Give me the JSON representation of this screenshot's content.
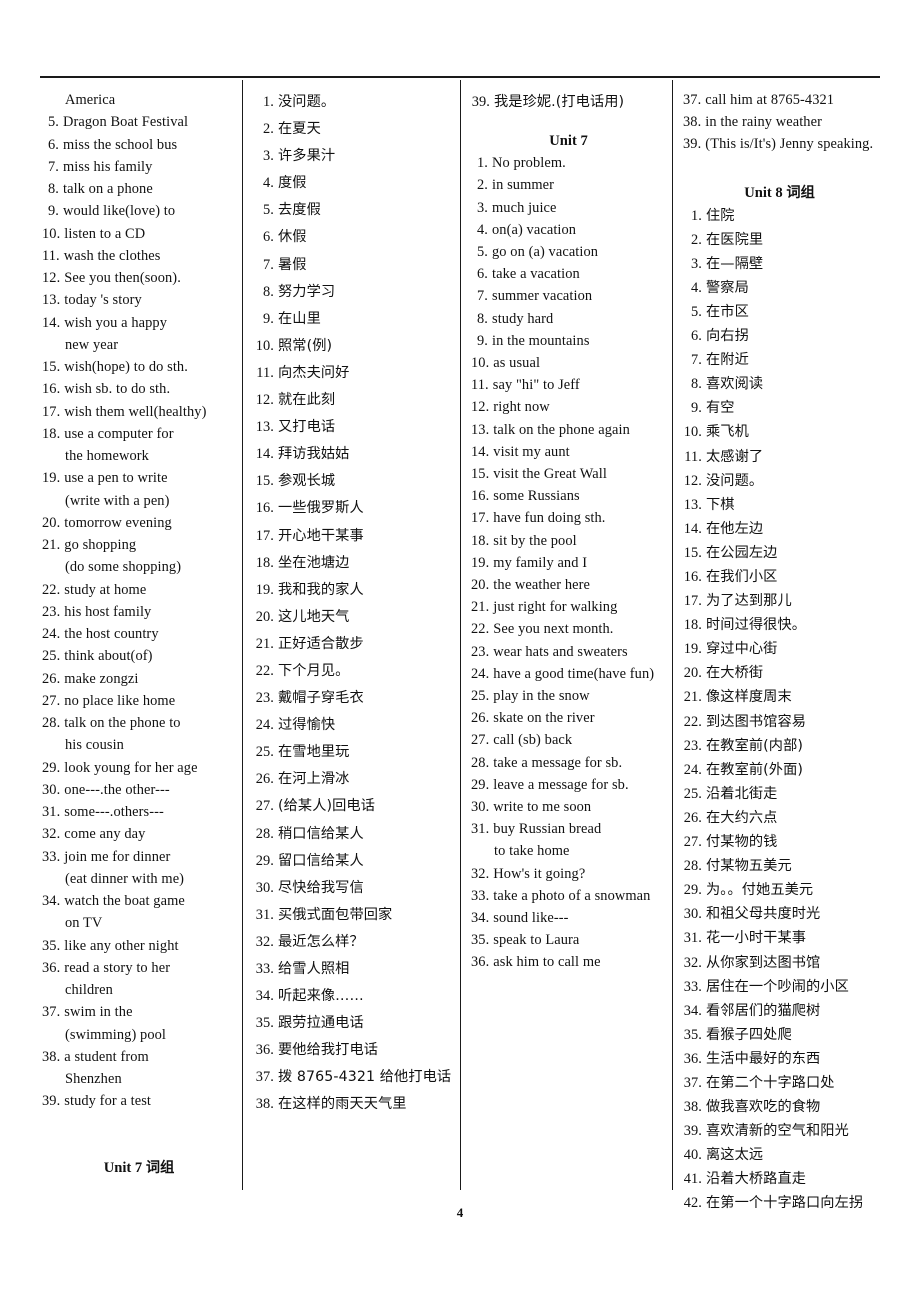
{
  "page": {
    "number": "4"
  },
  "columns": [
    {
      "id": "column-1",
      "lang": "en",
      "blocks": [
        {
          "type": "list",
          "items": [
            {
              "num": "",
              "text": "America",
              "cont": true
            },
            {
              "num": "5.",
              "text": "Dragon Boat Festival"
            },
            {
              "num": "6.",
              "text": "miss the school bus"
            },
            {
              "num": "7.",
              "text": "miss his family"
            },
            {
              "num": "8.",
              "text": "talk on a phone"
            },
            {
              "num": "9.",
              "text": "would like(love) to"
            },
            {
              "num": "10.",
              "text": "listen to a CD"
            },
            {
              "num": "11.",
              "text": "wash the clothes"
            },
            {
              "num": "12.",
              "text": "See you then(soon)."
            },
            {
              "num": "13.",
              "text": "today 's story"
            },
            {
              "num": "14.",
              "text": "wish you a happy"
            },
            {
              "num": "",
              "text": "new year",
              "cont": true
            },
            {
              "num": "15.",
              "text": "wish(hope) to do sth."
            },
            {
              "num": "16.",
              "text": "wish sb. to do sth."
            },
            {
              "num": "17.",
              "text": "wish them well(healthy)"
            },
            {
              "num": "18.",
              "text": "use a computer for"
            },
            {
              "num": "",
              "text": "the homework",
              "cont": true
            },
            {
              "num": "19.",
              "text": "use a pen to write"
            },
            {
              "num": "",
              "text": "(write with a pen)",
              "cont": true
            },
            {
              "num": "20.",
              "text": "tomorrow evening"
            },
            {
              "num": "21.",
              "text": "go shopping"
            },
            {
              "num": "",
              "text": "(do some shopping)",
              "cont": true
            },
            {
              "num": "22.",
              "text": "study at home"
            },
            {
              "num": "23.",
              "text": "his host family"
            },
            {
              "num": "24.",
              "text": "the host country"
            },
            {
              "num": "25.",
              "text": "think about(of)"
            },
            {
              "num": "26.",
              "text": "make zongzi"
            },
            {
              "num": "27.",
              "text": "no place like home"
            },
            {
              "num": "28.",
              "text": "talk on the phone to"
            },
            {
              "num": "",
              "text": "his cousin",
              "cont": true
            },
            {
              "num": "29.",
              "text": "look young for her age"
            },
            {
              "num": "30.",
              "text": "one---.the other---"
            },
            {
              "num": "31.",
              "text": "some---.others---"
            },
            {
              "num": "32.",
              "text": "come any day"
            },
            {
              "num": "33.",
              "text": "join me for dinner"
            },
            {
              "num": "",
              "text": "(eat dinner with me)",
              "cont": true
            },
            {
              "num": "34.",
              "text": "watch the boat game"
            },
            {
              "num": "",
              "text": "on TV",
              "cont": true
            },
            {
              "num": "35.",
              "text": "like any other night"
            },
            {
              "num": "36.",
              "text": "read a story to her"
            },
            {
              "num": "",
              "text": "children",
              "cont": true
            },
            {
              "num": "37.",
              "text": "swim in the"
            },
            {
              "num": "",
              "text": "(swimming) pool",
              "cont": true
            },
            {
              "num": "38.",
              "text": "a student from"
            },
            {
              "num": "",
              "text": "Shenzhen",
              "cont": true
            },
            {
              "num": "39.",
              "text": "study for a test"
            }
          ]
        },
        {
          "type": "spacer",
          "size": "lg"
        },
        {
          "type": "heading",
          "latin": "Unit 7",
          "zh": "词组"
        }
      ]
    },
    {
      "id": "column-2",
      "lang": "zh",
      "blocks": [
        {
          "type": "list",
          "items": [
            {
              "num": "1.",
              "text": "没问题。"
            },
            {
              "num": "2.",
              "text": "在夏天"
            },
            {
              "num": "3.",
              "text": "许多果汁"
            },
            {
              "num": "4.",
              "text": "度假"
            },
            {
              "num": "5.",
              "text": "去度假"
            },
            {
              "num": "6.",
              "text": "休假"
            },
            {
              "num": "7.",
              "text": "暑假"
            },
            {
              "num": "8.",
              "text": "努力学习"
            },
            {
              "num": "9.",
              "text": "在山里"
            },
            {
              "num": "10.",
              "text": "照常(例)"
            },
            {
              "num": "11.",
              "text": "向杰夫问好"
            },
            {
              "num": "12.",
              "text": "就在此刻"
            },
            {
              "num": "13.",
              "text": "又打电话"
            },
            {
              "num": "14.",
              "text": "拜访我姑姑"
            },
            {
              "num": "15.",
              "text": "参观长城"
            },
            {
              "num": "16.",
              "text": "一些俄罗斯人"
            },
            {
              "num": "17.",
              "text": "开心地干某事"
            },
            {
              "num": "18.",
              "text": "坐在池塘边"
            },
            {
              "num": "19.",
              "text": "我和我的家人"
            },
            {
              "num": "20.",
              "text": "这儿地天气"
            },
            {
              "num": "21.",
              "text": "正好适合散步"
            },
            {
              "num": "22.",
              "text": "下个月见。"
            },
            {
              "num": "23.",
              "text": "戴帽子穿毛衣"
            },
            {
              "num": "24.",
              "text": "过得愉快"
            },
            {
              "num": "25.",
              "text": "在雪地里玩"
            },
            {
              "num": "26.",
              "text": "在河上滑冰"
            },
            {
              "num": "27.",
              "text": "(给某人)回电话"
            },
            {
              "num": "28.",
              "text": "稍口信给某人"
            },
            {
              "num": "29.",
              "text": "留口信给某人"
            },
            {
              "num": "30.",
              "text": "尽快给我写信"
            },
            {
              "num": "31.",
              "text": "买俄式面包带回家"
            },
            {
              "num": "32.",
              "text": "最近怎么样？"
            },
            {
              "num": "33.",
              "text": "给雪人照相"
            },
            {
              "num": "34.",
              "text": "听起来像……"
            },
            {
              "num": "35.",
              "text": "跟劳拉通电话"
            },
            {
              "num": "36.",
              "text": "要他给我打电话"
            },
            {
              "num": "37.",
              "text": "拨 8765-4321 给他打电话"
            },
            {
              "num": "38.",
              "text": "在这样的雨天天气里"
            }
          ]
        }
      ]
    },
    {
      "id": "column-3",
      "lang": "mixed",
      "blocks": [
        {
          "type": "list",
          "lang": "zh",
          "items": [
            {
              "num": "39.",
              "text": "我是珍妮.(打电话用)"
            }
          ]
        },
        {
          "type": "spacer",
          "size": "sm"
        },
        {
          "type": "heading",
          "latin": "Unit 7",
          "zh": ""
        },
        {
          "type": "list",
          "lang": "en",
          "items": [
            {
              "num": "1.",
              "text": "No problem."
            },
            {
              "num": "2.",
              "text": "in summer"
            },
            {
              "num": "3.",
              "text": "much juice"
            },
            {
              "num": "4.",
              "text": "on(a) vacation"
            },
            {
              "num": "5.",
              "text": "go on (a) vacation"
            },
            {
              "num": "6.",
              "text": "take a vacation"
            },
            {
              "num": "7.",
              "text": "summer vacation"
            },
            {
              "num": "8.",
              "text": "study hard"
            },
            {
              "num": "9.",
              "text": "in the mountains"
            },
            {
              "num": "10.",
              "text": "as usual"
            },
            {
              "num": "11.",
              "text": "say \"hi\" to Jeff"
            },
            {
              "num": "12.",
              "text": "right now"
            },
            {
              "num": "13.",
              "text": "talk on the phone again"
            },
            {
              "num": "14.",
              "text": "visit my aunt"
            },
            {
              "num": "15.",
              "text": "visit the Great Wall"
            },
            {
              "num": "16.",
              "text": "some Russians"
            },
            {
              "num": "17.",
              "text": "have fun doing sth."
            },
            {
              "num": "18.",
              "text": "sit by the pool"
            },
            {
              "num": "19.",
              "text": "my family and I"
            },
            {
              "num": "20.",
              "text": "the weather here"
            },
            {
              "num": "21.",
              "text": "just right for walking"
            },
            {
              "num": "22.",
              "text": "See you next month."
            },
            {
              "num": "23.",
              "text": "wear hats and sweaters"
            },
            {
              "num": "24.",
              "text": "have a good time(have fun)"
            },
            {
              "num": "25.",
              "text": "play in the snow"
            },
            {
              "num": "26.",
              "text": "skate on the river"
            },
            {
              "num": "27.",
              "text": "call (sb) back"
            },
            {
              "num": "28.",
              "text": "take a message for sb."
            },
            {
              "num": "29.",
              "text": "leave a message for sb."
            },
            {
              "num": "30.",
              "text": "write to me soon"
            },
            {
              "num": "31.",
              "text": "buy Russian bread"
            },
            {
              "num": "",
              "text": "to take home",
              "cont": true
            },
            {
              "num": "32.",
              "text": "How's it going?"
            },
            {
              "num": "33.",
              "text": "take a photo of a snowman"
            },
            {
              "num": "34.",
              "text": "sound like---"
            },
            {
              "num": "35.",
              "text": "speak to Laura"
            },
            {
              "num": "36.",
              "text": "ask him to call me"
            }
          ]
        }
      ]
    },
    {
      "id": "column-4",
      "lang": "mixed",
      "blocks": [
        {
          "type": "list",
          "lang": "en",
          "items": [
            {
              "num": "37.",
              "text": "call him at 8765-4321"
            },
            {
              "num": "38.",
              "text": "in the rainy weather"
            },
            {
              "num": "39.",
              "text": "(This is/It's) Jenny speaking."
            }
          ]
        },
        {
          "type": "spacer",
          "size": "md"
        },
        {
          "type": "heading",
          "latin": "Unit 8",
          "zh": "词组"
        },
        {
          "type": "list",
          "lang": "zh",
          "tight": true,
          "items": [
            {
              "num": "1.",
              "text": "住院"
            },
            {
              "num": "2.",
              "text": "在医院里"
            },
            {
              "num": "3.",
              "text": "在—隔壁"
            },
            {
              "num": "4.",
              "text": "警察局"
            },
            {
              "num": "5.",
              "text": "在市区"
            },
            {
              "num": "6.",
              "text": "向右拐"
            },
            {
              "num": "7.",
              "text": "在附近"
            },
            {
              "num": "8.",
              "text": "喜欢阅读"
            },
            {
              "num": "9.",
              "text": "有空"
            },
            {
              "num": "10.",
              "text": "乘飞机"
            },
            {
              "num": "11.",
              "text": "太感谢了"
            },
            {
              "num": "12.",
              "text": "没问题。"
            },
            {
              "num": "13.",
              "text": "下棋"
            },
            {
              "num": "14.",
              "text": "在他左边"
            },
            {
              "num": "15.",
              "text": "在公园左边"
            },
            {
              "num": "16.",
              "text": "在我们小区"
            },
            {
              "num": "17.",
              "text": "为了达到那儿"
            },
            {
              "num": "18.",
              "text": "时间过得很快。"
            },
            {
              "num": "19.",
              "text": "穿过中心街"
            },
            {
              "num": "20.",
              "text": "在大桥街"
            },
            {
              "num": "21.",
              "text": "像这样度周末"
            },
            {
              "num": "22.",
              "text": "到达图书馆容易"
            },
            {
              "num": "23.",
              "text": "在教室前(内部)"
            },
            {
              "num": "24.",
              "text": "在教室前(外面)"
            },
            {
              "num": "25.",
              "text": "沿着北街走"
            },
            {
              "num": "26.",
              "text": "在大约六点"
            },
            {
              "num": "27.",
              "text": "付某物的钱"
            },
            {
              "num": "28.",
              "text": "付某物五美元"
            },
            {
              "num": "29.",
              "text": "为。。付她五美元"
            },
            {
              "num": "30.",
              "text": "和祖父母共度时光"
            },
            {
              "num": "31.",
              "text": "花一小时干某事"
            },
            {
              "num": "32.",
              "text": "从你家到达图书馆"
            },
            {
              "num": "33.",
              "text": "居住在一个吵闹的小区"
            },
            {
              "num": "34.",
              "text": "看邻居们的猫爬树"
            },
            {
              "num": "35.",
              "text": "看猴子四处爬"
            },
            {
              "num": "36.",
              "text": "生活中最好的东西"
            },
            {
              "num": "37.",
              "text": "在第二个十字路口处"
            },
            {
              "num": "38.",
              "text": "做我喜欢吃的食物"
            },
            {
              "num": "39.",
              "text": "喜欢清新的空气和阳光"
            },
            {
              "num": "40.",
              "text": "离这太远"
            },
            {
              "num": "41.",
              "text": "沿着大桥路直走"
            },
            {
              "num": "42.",
              "text": "在第一个十字路口向左拐"
            }
          ]
        }
      ]
    }
  ]
}
